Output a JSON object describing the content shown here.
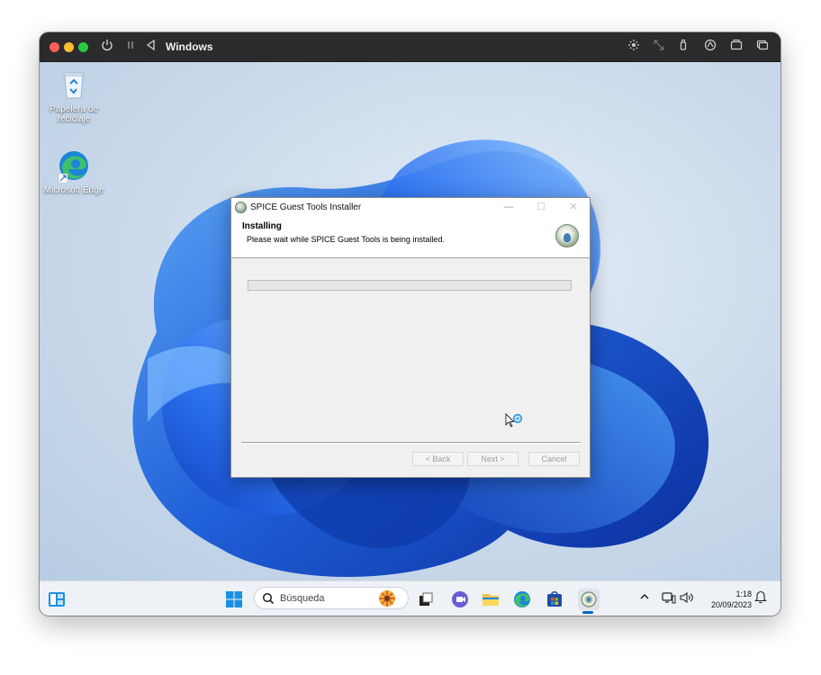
{
  "vm_window": {
    "title": "Windows",
    "toolbar_icons": [
      "power-icon",
      "pause-icon",
      "back-icon",
      "brightness-icon",
      "resize-icon",
      "usb-icon",
      "folder-share-icon",
      "camera-icon",
      "windows-icon"
    ]
  },
  "desktop": {
    "icons": [
      {
        "label": "Papelera de reciclaje",
        "icon": "recycle-bin-icon"
      },
      {
        "label": "Microsoft Edge",
        "icon": "edge-icon"
      }
    ]
  },
  "installer": {
    "title": "SPICE Guest Tools Installer",
    "heading": "Installing",
    "subheading": "Please wait while SPICE Guest Tools is being installed.",
    "progress": 0,
    "buttons": {
      "back": "< Back",
      "next": "Next >",
      "cancel": "Cancel"
    },
    "window_controls": {
      "minimize": "—",
      "maximize": "☐",
      "close": "✕"
    }
  },
  "taskbar": {
    "search_placeholder": "Búsqueda",
    "pinned": [
      "widgets-icon",
      "start-icon",
      "task-view-icon",
      "teams-icon",
      "file-explorer-icon",
      "edge-icon",
      "store-icon",
      "spice-installer-icon"
    ],
    "active_app": "spice-installer-icon",
    "clock_time": "1:18",
    "clock_date": "20/09/2023"
  },
  "colors": {
    "accent": "#0067c0",
    "desktop_bg": "#cfdded",
    "bloom": "#1f5fd8"
  }
}
